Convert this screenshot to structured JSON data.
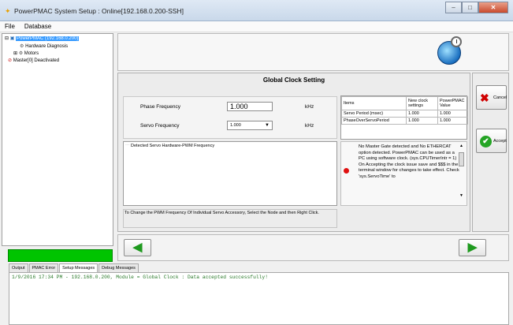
{
  "window": {
    "title": "PowerPMAC System Setup  : Online[192.168.0.200-SSH]",
    "buttons": [
      "–",
      "□",
      "✕"
    ]
  },
  "menu": [
    "File",
    "Database"
  ],
  "tree": {
    "root": "PowerPMAC (192.168.0.200)",
    "items": [
      "Hardware Diagnosis",
      "Motors",
      "Master[0] Deactivated"
    ],
    "expanders": [
      "⊟",
      "⊞"
    ]
  },
  "panel": {
    "title": "Global Clock Setting",
    "phase_label": "Phase Frequency",
    "phase_value": "1.000",
    "phase_unit": "kHz",
    "servo_label": "Servo Frequency",
    "servo_value": "1.000",
    "servo_unit": "kHz",
    "detect_title": "Detected Servo Hardware-PWM Frequency",
    "note": "To Change the PWM Frequency Of Individual Servo Accessory, Select the Node and then Right Click.",
    "message": "No Master Gate detected and No ETHERCAT option detected. PowerPMAC can be used as a PC using software clock. (sys.CPUTimerIntr = 1) On Accepting the clock issue save and $$$ in the terminal window for changes to take effect. Check 'sys.ServoTime' to"
  },
  "clock_table": {
    "headers": [
      "Items",
      "New clock settings",
      "PowerPMAC Value"
    ],
    "rows": [
      [
        "Servo Period (msec)",
        "1.000",
        "1.000"
      ],
      [
        "PhaseOverServoPeriod",
        "1.000",
        "1.000"
      ]
    ]
  },
  "side_buttons": {
    "cancel": "Cancel",
    "accept": "Accept",
    "cancel_icon": "✖",
    "accept_icon": "✔"
  },
  "nav": {
    "back": "◀",
    "next": "▶"
  },
  "tabs": [
    "Output",
    "PMAC Error",
    "Setup Messages",
    "Debug Messages"
  ],
  "active_tab": "Setup Messages",
  "log": [
    "1/9/2016 17:34 PM - 192.168.0.200, Module = Global Clock : Data accepted successfully!"
  ],
  "scroll": {
    "up": "▲",
    "down": "▼"
  },
  "select_arrow": "▼"
}
